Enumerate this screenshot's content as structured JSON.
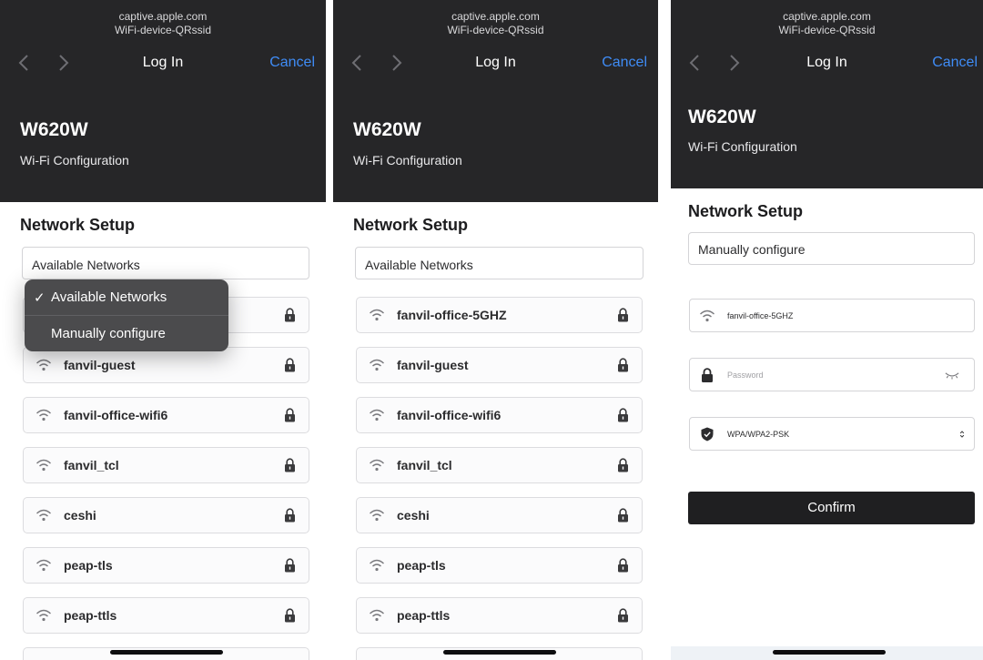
{
  "browser": {
    "host": "captive.apple.com",
    "ssid": "WiFi-device-QRssid",
    "title": "Log In",
    "cancel": "Cancel"
  },
  "device": {
    "model": "W620W",
    "subtitle": "Wi-Fi Configuration"
  },
  "setup": {
    "heading": "Network Setup",
    "selected_mode": "Available Networks",
    "manual_mode": "Manually configure"
  },
  "dropdown": {
    "check": "✓",
    "options": [
      "Available Networks",
      "Manually configure"
    ]
  },
  "networks": [
    "fanvil-office-5GHZ",
    "fanvil-guest",
    "fanvil-office-wifi6",
    "fanvil_tcl",
    "ceshi",
    "peap-tls",
    "peap-ttls"
  ],
  "manual_form": {
    "ssid_value": "fanvil-office-5GHZ",
    "password_placeholder": "Password",
    "security_value": "WPA/WPA2-PSK",
    "confirm_label": "Confirm"
  },
  "icons": {
    "wifi": "wifi-icon",
    "lock": "lock-icon",
    "eye": "eye-closed-icon",
    "shield": "shield-icon",
    "stepper": "chevron-updown-icon"
  },
  "colors": {
    "header_bg": "#262628",
    "accent": "#3f8cf6",
    "confirm_bg": "#1f1f21"
  }
}
